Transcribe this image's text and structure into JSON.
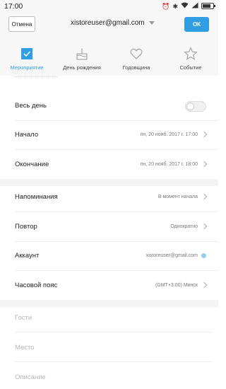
{
  "status_bar": {
    "time": "17:00"
  },
  "header": {
    "cancel_label": "Отмена",
    "account_email": "xistoreuser@gmail.com",
    "ok_label": "ОК"
  },
  "event_types": [
    {
      "label": "Мероприятие",
      "icon": "checkbox-icon",
      "active": true
    },
    {
      "label": "День рождения",
      "icon": "cake-icon",
      "active": false
    },
    {
      "label": "Годовщина",
      "icon": "heart-icon",
      "active": false
    },
    {
      "label": "Событие",
      "icon": "star-icon",
      "active": false
    }
  ],
  "form": {
    "all_day": {
      "label": "Весь день",
      "enabled": false
    },
    "start": {
      "label": "Начало",
      "value": "пн, 20 нояб. 2017 г. 17:00"
    },
    "end": {
      "label": "Окончание",
      "value": "пн, 20 нояб. 2017 г. 18:00"
    },
    "reminders": {
      "label": "Напоминания",
      "value": "В момент начала"
    },
    "repeat": {
      "label": "Повтор",
      "value": "Однократно"
    },
    "account": {
      "label": "Аккаунт",
      "value": "xistoreuser@gmail.com",
      "color": "#8fd0ea"
    },
    "timezone": {
      "label": "Часовой пояс",
      "value": "(GMT+3:00) Минск"
    },
    "guests_placeholder": "Гости",
    "location_placeholder": "Место",
    "description_placeholder": "Описание"
  },
  "colors": {
    "accent": "#2f9ee3"
  }
}
